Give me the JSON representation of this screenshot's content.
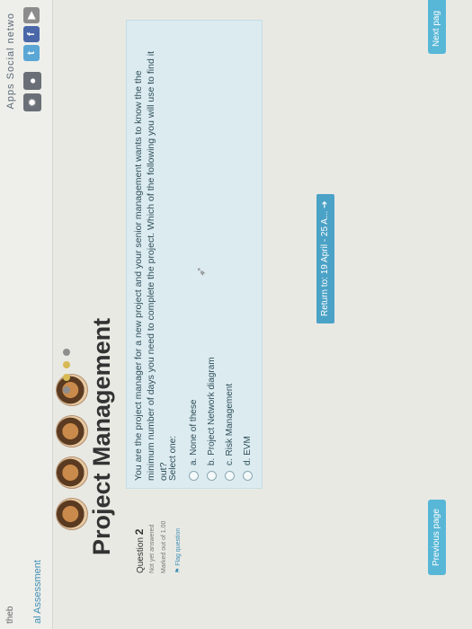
{
  "header": {
    "brand": "theb",
    "apps_label": "Apps",
    "social_label": "Social netwo"
  },
  "breadcrumb": "al Assessment",
  "page_title": "Project Management",
  "question": {
    "number_label": "Question",
    "number": "2",
    "status": "Not yet answered",
    "marked_out_of": "Marked out of 1.00",
    "flag_label": "Flag question",
    "text": "You are the project manager for a new project and your senior management wants to know the the minimum number of days you need to complete the project. Which of the following you will use to find it out?",
    "select_one": "Select one:",
    "options": [
      "a. None of these",
      "b. Project Network diagram",
      "c. Risk Management",
      "d. EVM"
    ]
  },
  "return_link": "Return to: 19 April - 25 A...",
  "prev_button": "Previous page",
  "next_button": "Next pag",
  "colors": {
    "accent": "#58b7d6",
    "question_bg": "#dcebf0",
    "link": "#3d8fb6"
  }
}
